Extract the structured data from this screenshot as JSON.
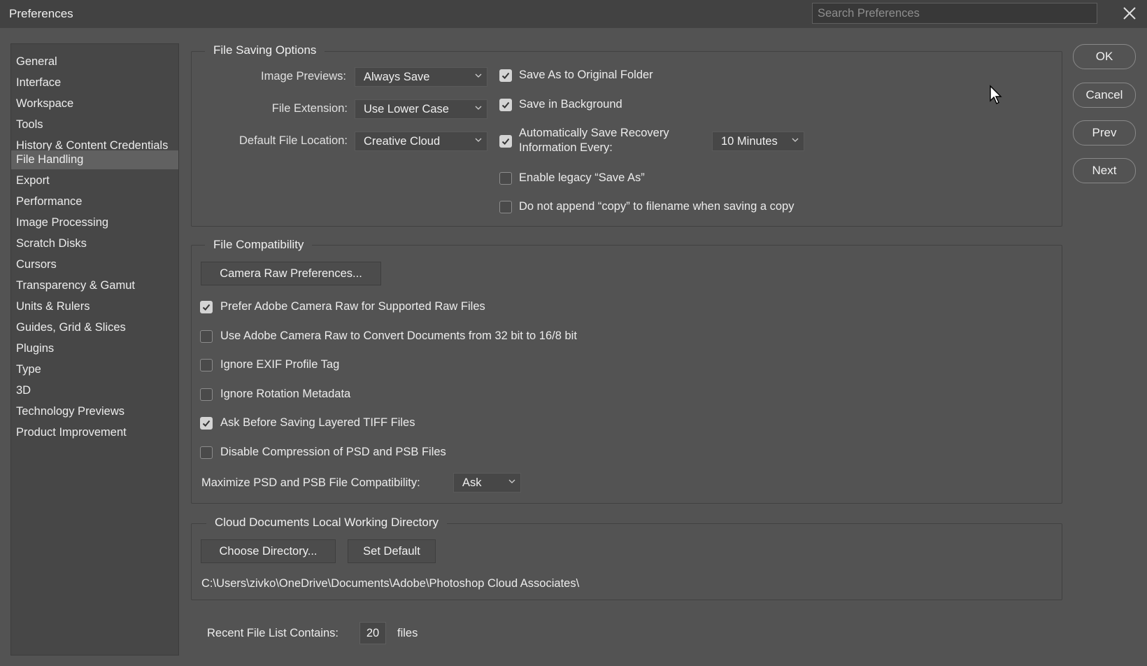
{
  "window": {
    "title": "Preferences",
    "search_placeholder": "Search Preferences"
  },
  "sidebar": {
    "items": [
      "General",
      "Interface",
      "Workspace",
      "Tools",
      "History & Content Credentials",
      "File Handling",
      "Export",
      "Performance",
      "Image Processing",
      "Scratch Disks",
      "Cursors",
      "Transparency & Gamut",
      "Units & Rulers",
      "Guides, Grid & Slices",
      "Plugins",
      "Type",
      "3D",
      "Technology Previews",
      "Product Improvement"
    ],
    "active": "File Handling"
  },
  "file_saving": {
    "legend": "File Saving Options",
    "image_previews": {
      "label": "Image Previews:",
      "value": "Always Save"
    },
    "file_extension": {
      "label": "File Extension:",
      "value": "Use Lower Case"
    },
    "default_location": {
      "label": "Default File Location:",
      "value": "Creative Cloud"
    },
    "save_original": {
      "label": "Save As to Original Folder",
      "checked": true
    },
    "save_background": {
      "label": "Save in Background",
      "checked": true
    },
    "auto_recovery": {
      "label_line1": "Automatically Save Recovery",
      "label_line2": "Information Every:",
      "checked": true,
      "interval": "10 Minutes"
    },
    "legacy_save_as": {
      "label": "Enable legacy “Save As”",
      "checked": false
    },
    "no_append_copy": {
      "label": "Do not append “copy” to filename when saving a copy",
      "checked": false
    }
  },
  "compatibility": {
    "legend": "File Compatibility",
    "camera_raw_button": "Camera Raw Preferences...",
    "options": [
      {
        "label": "Prefer Adobe Camera Raw for Supported Raw Files",
        "checked": true
      },
      {
        "label": "Use Adobe Camera Raw to Convert Documents from 32 bit to 16/8 bit",
        "checked": false
      },
      {
        "label": "Ignore EXIF Profile Tag",
        "checked": false
      },
      {
        "label": "Ignore Rotation Metadata",
        "checked": false
      },
      {
        "label": "Ask Before Saving Layered TIFF Files",
        "checked": true
      },
      {
        "label": "Disable Compression of PSD and PSB Files",
        "checked": false
      }
    ],
    "maximize": {
      "label": "Maximize PSD and PSB File Compatibility:",
      "value": "Ask"
    }
  },
  "cloud": {
    "legend": "Cloud Documents Local Working Directory",
    "choose_button": "Choose Directory...",
    "default_button": "Set Default",
    "path": "C:\\Users\\zivko\\OneDrive\\Documents\\Adobe\\Photoshop Cloud Associates\\"
  },
  "recent": {
    "label": "Recent File List Contains:",
    "value": "20",
    "suffix": "files"
  },
  "buttons": {
    "ok": "OK",
    "cancel": "Cancel",
    "prev": "Prev",
    "next": "Next"
  }
}
